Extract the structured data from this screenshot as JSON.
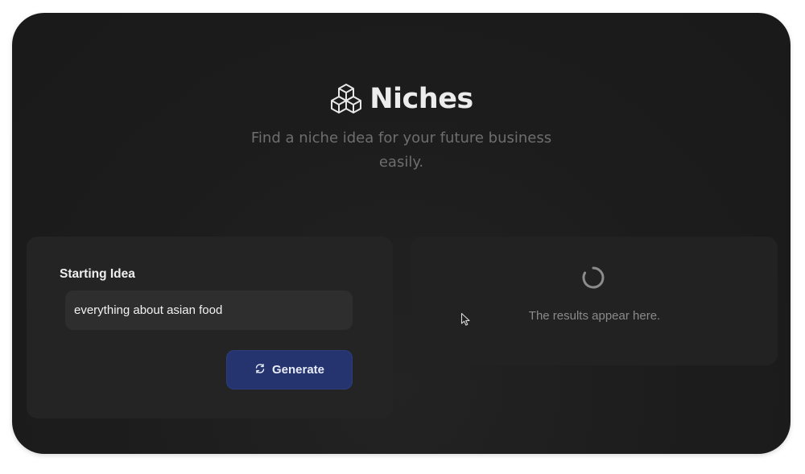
{
  "app": {
    "title": "Niches",
    "logo_icon": "cubes-icon",
    "subtitle_line1": "Find a niche idea for your future business",
    "subtitle_line2": "easily."
  },
  "form": {
    "label": "Starting Idea",
    "input_value": "everything about asian food",
    "button_label": "Generate",
    "button_icon": "refresh-icon"
  },
  "results": {
    "placeholder": "The results appear here.",
    "loading_icon": "spinner-icon"
  },
  "colors": {
    "background": "#1c1c1c",
    "panel": "#242424",
    "button": "#25346e",
    "title": "#ececec",
    "muted_text": "#6e6e6e"
  }
}
